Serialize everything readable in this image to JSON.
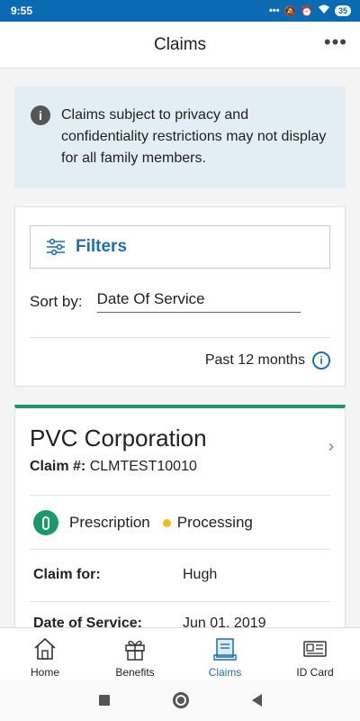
{
  "status_bar": {
    "time": "9:55",
    "battery": "35"
  },
  "header": {
    "title": "Claims",
    "more_label": "•••"
  },
  "notice": {
    "icon": "info-icon",
    "icon_glyph": "i",
    "text": "Claims subject to privacy and confidentiality restrictions may not display for all family members."
  },
  "filters": {
    "label": "Filters",
    "sort_label": "Sort by:",
    "sort_value": "Date Of Service",
    "range_label": "Past 12 months",
    "range_info_glyph": "i"
  },
  "claim": {
    "provider": "PVC Corporation",
    "number_label": "Claim #:",
    "number_value": "CLMTEST10010",
    "chevron": "›",
    "type": "Prescription",
    "status": "Processing",
    "status_color": "#e8c21b",
    "accent_color": "#1a9a6c",
    "details": [
      {
        "label": "Claim for:",
        "value": "Hugh"
      },
      {
        "label": "Date of Service:",
        "value": "Jun 01, 2019"
      }
    ]
  },
  "bottom_nav": {
    "items": [
      {
        "label": "Home",
        "icon": "home-icon",
        "active": false
      },
      {
        "label": "Benefits",
        "icon": "gift-icon",
        "active": false
      },
      {
        "label": "Claims",
        "icon": "claims-icon",
        "active": true
      },
      {
        "label": "ID Card",
        "icon": "id-card-icon",
        "active": false
      }
    ]
  }
}
